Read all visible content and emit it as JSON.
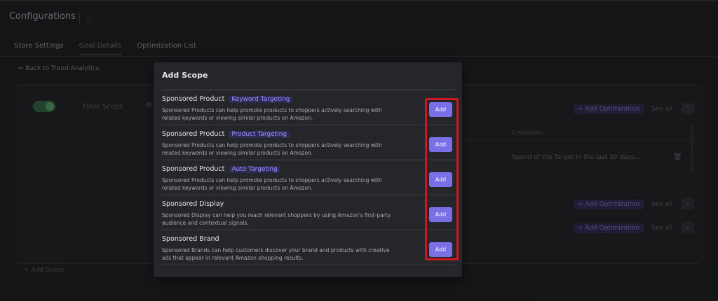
{
  "page": {
    "title": "Configurations",
    "tabs": [
      {
        "label": "Store Settings"
      },
      {
        "label": "Goal Details"
      },
      {
        "label": "Optimization List"
      }
    ],
    "back_link": "Back to Trend Analytics",
    "scope_card": {
      "scope_label": "Filter Scope",
      "add_optimization_label": "+ Add Optimization",
      "see_all_label": "See all",
      "condition_header": "Condition",
      "condition_text": "Spend of the Target in the last 30 days..."
    },
    "add_scope_link": "+ Add Scope"
  },
  "modal": {
    "title": "Add Scope",
    "items": [
      {
        "name": "Sponsored Product",
        "tag": "Keyword Targeting",
        "description": "Sponsored Products can help promote products to shoppers actively searching with related keywords or viewing similar products on Amazon.",
        "button": "Add"
      },
      {
        "name": "Sponsored Product",
        "tag": "Product Targeting",
        "description": "Sponsored Products can help promote products to shoppers actively searching with related keywords or viewing similar products on Amazon.",
        "button": "Add"
      },
      {
        "name": "Sponsored Product",
        "tag": "Auto Targeting",
        "description": "Sponsored Products can help promote products to shoppers actively searching with related keywords or viewing similar products on Amazon.",
        "button": "Add"
      },
      {
        "name": "Sponsored Display",
        "tag": "",
        "description": "Sponsored Display can help you reach relevant shoppers by using Amazon's first-party audience and contextual signals.",
        "button": "Add"
      },
      {
        "name": "Sponsored Brand",
        "tag": "",
        "description": "Sponsored Brands can help customers discover your brand and products with creative ads that appear in relevant Amazon shopping results.",
        "button": "Add"
      }
    ]
  },
  "colors": {
    "accent": "#7b6fe6",
    "tag_text": "#9d95ff",
    "highlight": "#d0171f",
    "modal_bg": "#24262a",
    "page_bg": "#1c1d20"
  }
}
